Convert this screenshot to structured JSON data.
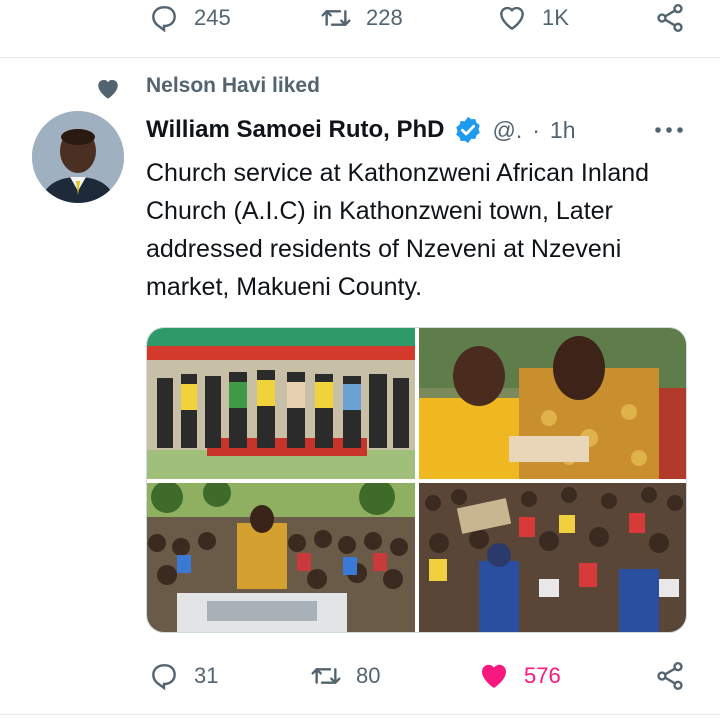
{
  "previous_tweet_actions": {
    "reply_count": "245",
    "retweet_count": "228",
    "like_count": "1K"
  },
  "social_context": {
    "text": "Nelson Havi liked"
  },
  "tweet": {
    "author_name": "William Samoei Ruto, PhD",
    "handle": "@.",
    "separator": "·",
    "time": "1h",
    "text": "Church service at Kathonzweni African Inland Church (A.I.C) in Kathonzweni town, Later addressed residents of Nzeveni at Nzeveni market, Makueni County.",
    "photos": [
      {
        "name": "photo-church-group"
      },
      {
        "name": "photo-church-service"
      },
      {
        "name": "photo-crowd-rally"
      },
      {
        "name": "photo-market-crowd"
      }
    ],
    "actions": {
      "reply_count": "31",
      "retweet_count": "80",
      "like_count": "576",
      "liked": true
    }
  },
  "colors": {
    "secondary_text": "#536471",
    "like_active": "#f91880",
    "verified_blue": "#1d9bf0",
    "divider": "#e6ecf0"
  }
}
